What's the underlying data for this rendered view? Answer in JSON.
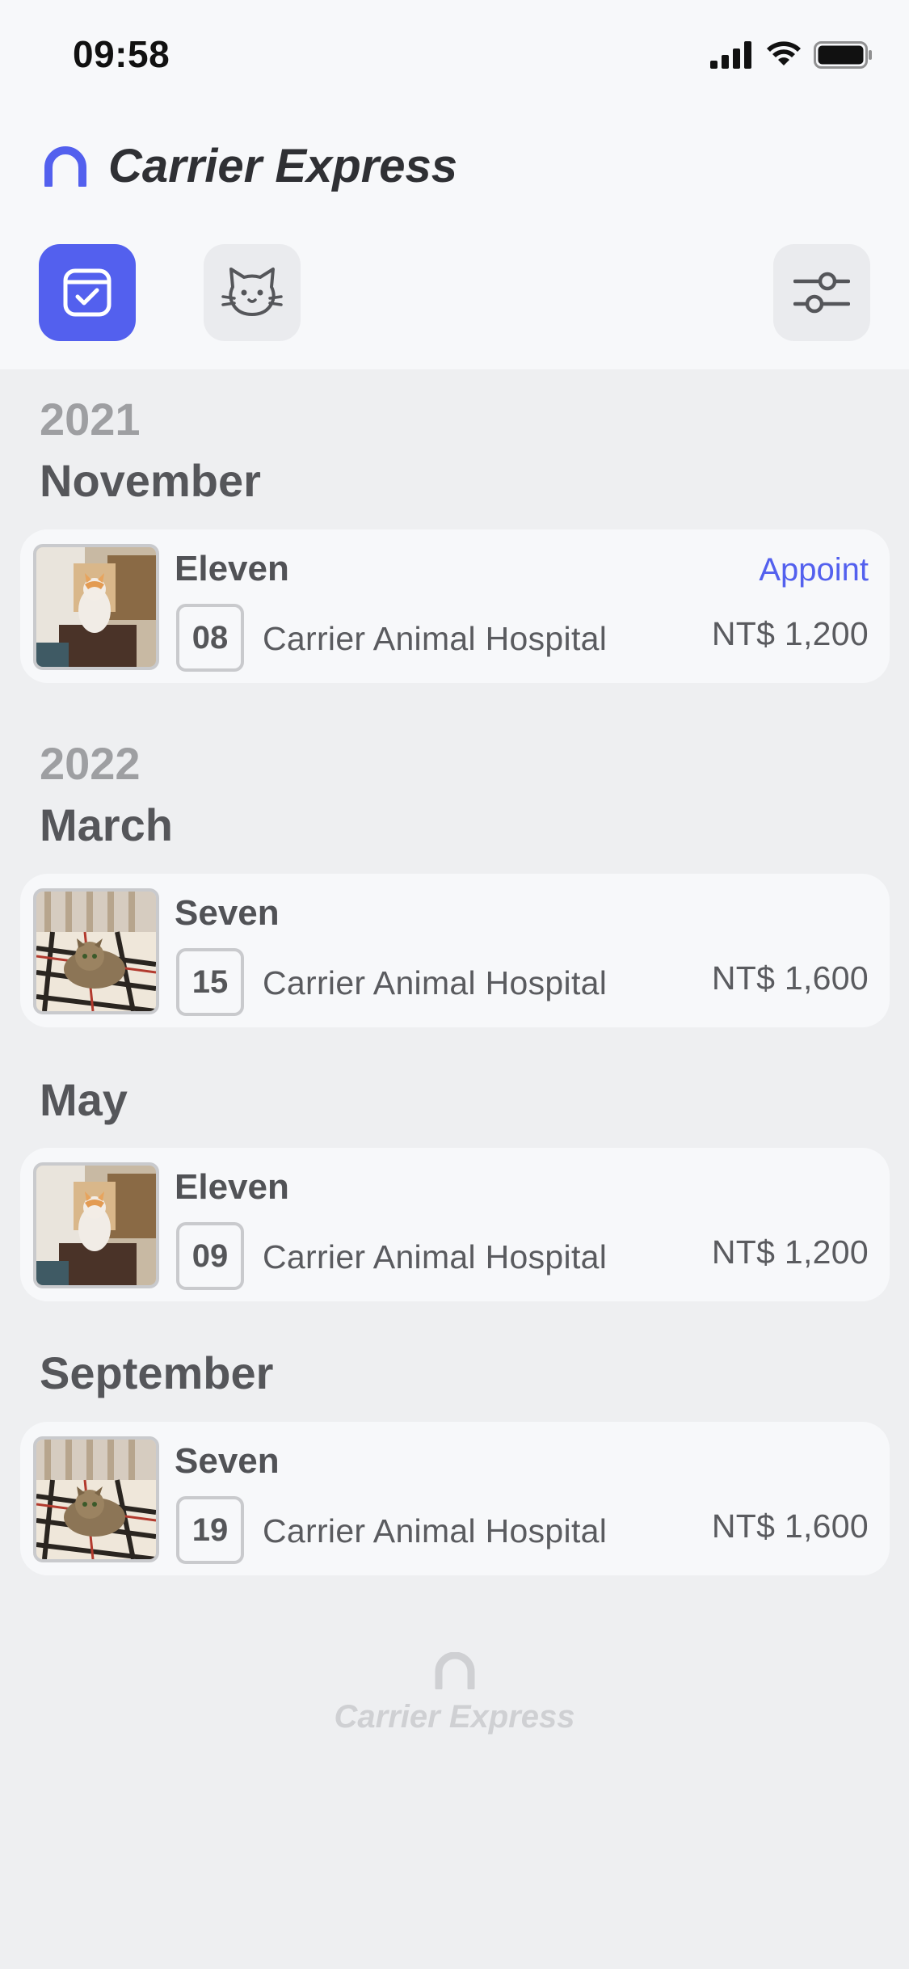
{
  "status_bar": {
    "time": "09:58"
  },
  "header": {
    "app_name": "Carrier Express"
  },
  "toolbar": {
    "calendar_icon": "calendar-check-icon",
    "cat_icon": "cat-face-icon",
    "filter_icon": "sliders-icon",
    "accent_color": "#5360ee"
  },
  "groups": [
    {
      "year": "2021",
      "month": "November",
      "entries": [
        {
          "pet": "Eleven",
          "day": "08",
          "clinic": "Carrier Animal Hospital",
          "price": "NT$ 1,200",
          "status": "Appoint",
          "photo": "white-orange cat"
        }
      ]
    },
    {
      "year": "2022",
      "month": "March",
      "entries": [
        {
          "pet": "Seven",
          "day": "15",
          "clinic": "Carrier Animal Hospital",
          "price": "NT$ 1,600",
          "photo": "tabby cat on plaid blanket"
        }
      ]
    },
    {
      "month": "May",
      "entries": [
        {
          "pet": "Eleven",
          "day": "09",
          "clinic": "Carrier Animal Hospital",
          "price": "NT$ 1,200",
          "photo": "white-orange cat"
        }
      ]
    },
    {
      "month": "September",
      "entries": [
        {
          "pet": "Seven",
          "day": "19",
          "clinic": "Carrier Animal Hospital",
          "price": "NT$ 1,600",
          "photo": "tabby cat on plaid blanket"
        }
      ]
    }
  ],
  "footer": {
    "brand": "Carrier Express"
  }
}
